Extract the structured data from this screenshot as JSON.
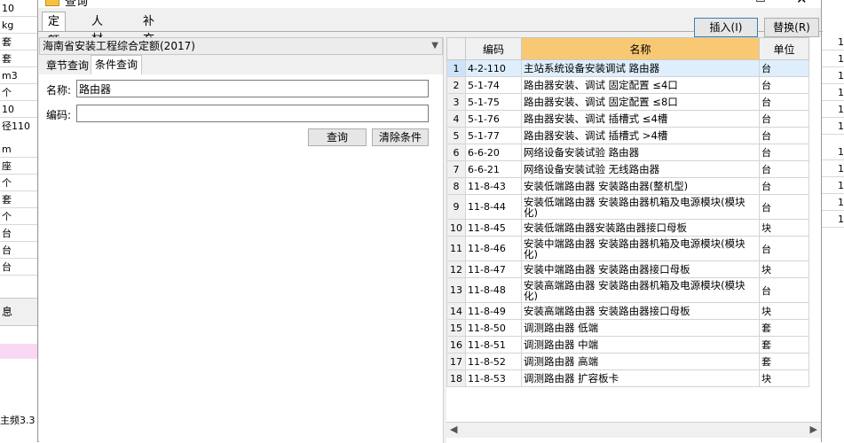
{
  "background": {
    "left_cells": [
      "10",
      "kg",
      "套",
      "套",
      "m3",
      "个",
      "10",
      "m",
      "座",
      "个",
      "套",
      "个",
      "台",
      "台",
      "台"
    ],
    "left_cell_extra": "径110",
    "info_tab": "息",
    "status_text": "主频3.3",
    "right_cells": [
      "1",
      "1",
      "1",
      "1",
      "1",
      "1",
      "1",
      "1",
      "1",
      "1",
      "1"
    ]
  },
  "dialog": {
    "title": "查询",
    "maximize_glyph": "☐",
    "close_glyph": "✕",
    "tabs": [
      "定额",
      "人材机",
      "补充人材机"
    ],
    "insert_button": "插入(I)",
    "replace_button": "替换(R)",
    "quota_library": "海南省安装工程综合定额(2017)",
    "subtabs": [
      "章节查询",
      "条件查询"
    ],
    "form": {
      "name_label": "名称:",
      "name_value": "路由器",
      "code_label": "编码:",
      "code_value": "",
      "query_button": "查询",
      "clear_button": "清除条件"
    },
    "grid": {
      "columns": [
        "",
        "编码",
        "名称",
        "单位"
      ],
      "rows": [
        {
          "idx": "1",
          "code": "4-2-110",
          "name": "主站系统设备安装调试 路由器",
          "unit": "台"
        },
        {
          "idx": "2",
          "code": "5-1-74",
          "name": "路由器安装、调试 固定配置 ≤4口",
          "unit": "台"
        },
        {
          "idx": "3",
          "code": "5-1-75",
          "name": "路由器安装、调试 固定配置 ≤8口",
          "unit": "台"
        },
        {
          "idx": "4",
          "code": "5-1-76",
          "name": "路由器安装、调试 插槽式 ≤4槽",
          "unit": "台"
        },
        {
          "idx": "5",
          "code": "5-1-77",
          "name": "路由器安装、调试 插槽式 >4槽",
          "unit": "台"
        },
        {
          "idx": "6",
          "code": "6-6-20",
          "name": "网络设备安装试验 路由器",
          "unit": "台"
        },
        {
          "idx": "7",
          "code": "6-6-21",
          "name": "网络设备安装试验 无线路由器",
          "unit": "台"
        },
        {
          "idx": "8",
          "code": "11-8-43",
          "name": "安装低端路由器 安装路由器(整机型)",
          "unit": "台"
        },
        {
          "idx": "9",
          "code": "11-8-44",
          "name": "安装低端路由器 安装路由器机箱及电源模块(模块化)",
          "unit": "台"
        },
        {
          "idx": "10",
          "code": "11-8-45",
          "name": "安装低端路由器安装路由器接口母板",
          "unit": "块"
        },
        {
          "idx": "11",
          "code": "11-8-46",
          "name": "安装中端路由器 安装路由器机箱及电源模块(模块化)",
          "unit": "台"
        },
        {
          "idx": "12",
          "code": "11-8-47",
          "name": "安装中端路由器 安装路由器接口母板",
          "unit": "块"
        },
        {
          "idx": "13",
          "code": "11-8-48",
          "name": "安装高端路由器 安装路由器机箱及电源模块(模块化)",
          "unit": "台"
        },
        {
          "idx": "14",
          "code": "11-8-49",
          "name": "安装高端路由器 安装路由器接口母板",
          "unit": "块"
        },
        {
          "idx": "15",
          "code": "11-8-50",
          "name": "调测路由器 低端",
          "unit": "套"
        },
        {
          "idx": "16",
          "code": "11-8-51",
          "name": "调测路由器 中端",
          "unit": "套"
        },
        {
          "idx": "17",
          "code": "11-8-52",
          "name": "调测路由器 高端",
          "unit": "套"
        },
        {
          "idx": "18",
          "code": "11-8-53",
          "name": "调测路由器 扩容板卡",
          "unit": "块"
        }
      ]
    }
  }
}
